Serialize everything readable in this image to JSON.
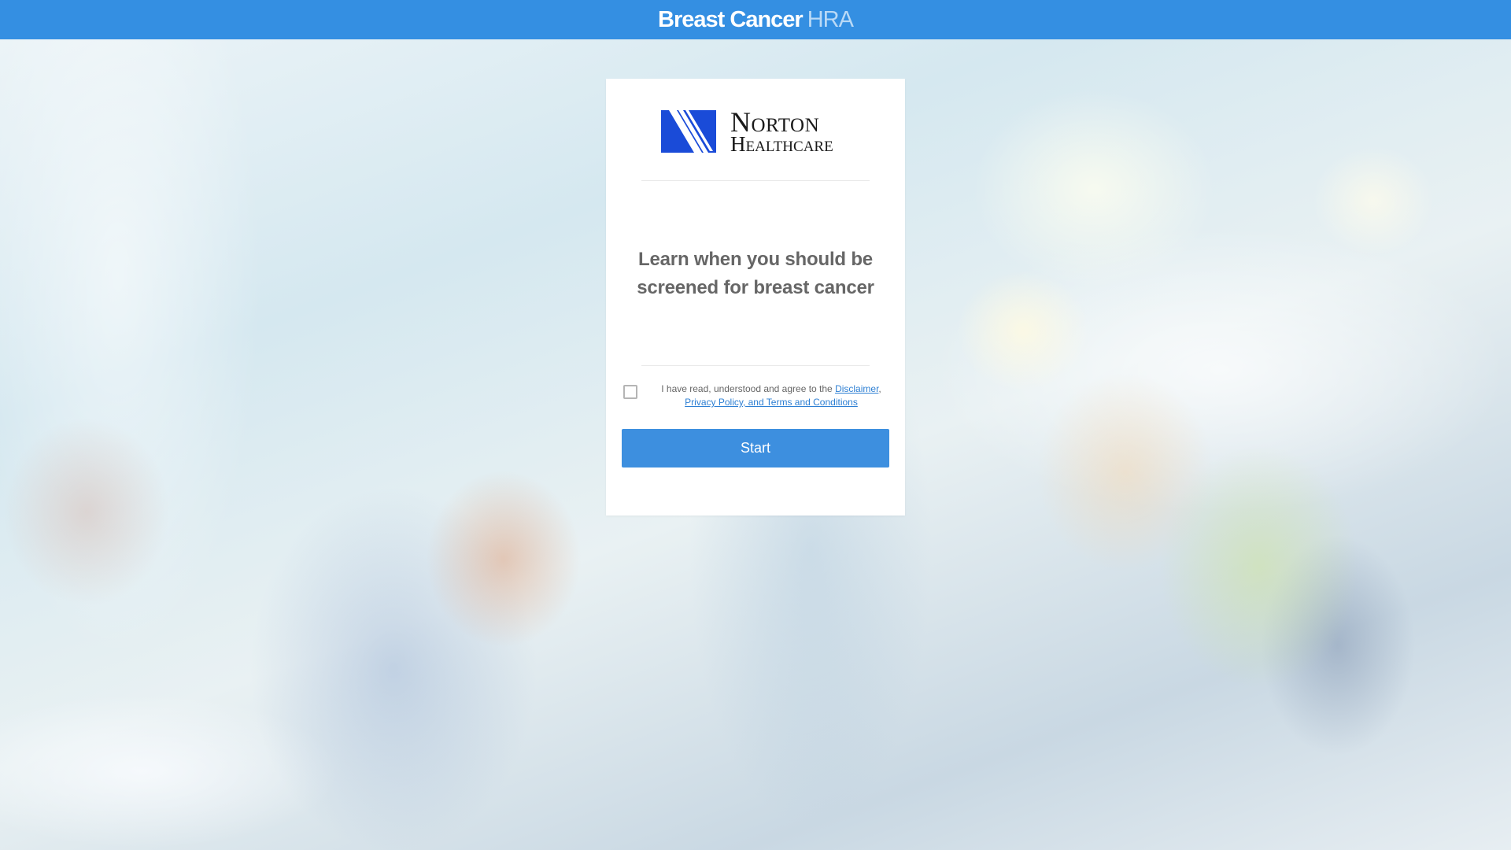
{
  "header": {
    "title_main": "Breast Cancer",
    "title_suffix": "HRA"
  },
  "logo": {
    "line1": "Norton",
    "line2": "Healthcare",
    "icon": "norton-n-logo-icon",
    "color": "#1a4bd8"
  },
  "card": {
    "headline": "Learn when you should be screened for breast cancer",
    "agreement": {
      "checked": false,
      "text_prefix": "I have read, understood and agree to the ",
      "link1": "Disclaimer",
      "separator": ", ",
      "link2": "Privacy Policy, and Terms and Conditions"
    },
    "start_label": "Start"
  },
  "colors": {
    "header_bg": "#348fe2",
    "button_bg": "#3d8fdf",
    "link": "#2d7fd3",
    "headline_text": "#666666"
  }
}
